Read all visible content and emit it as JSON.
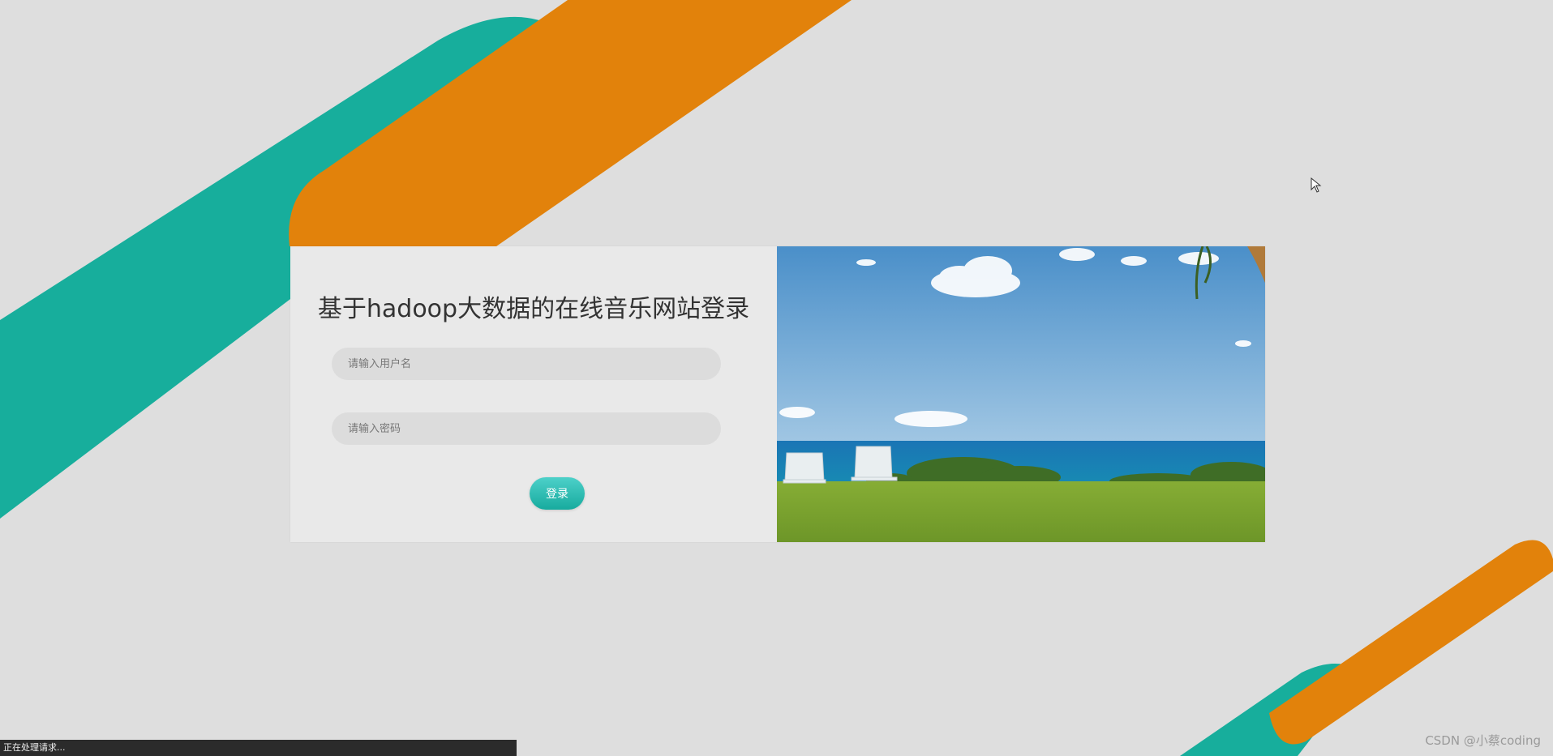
{
  "login": {
    "title": "基于hadoop大数据的在线音乐网站登录",
    "username_placeholder": "请输入用户名",
    "password_placeholder": "请输入密码",
    "login_label": "登录"
  },
  "status_bar": {
    "text": "正在处理请求..."
  },
  "watermark": {
    "text": "CSDN @小蔡coding"
  },
  "colors": {
    "background": "#dedede",
    "teal": "#17ae9c",
    "orange": "#e2820b",
    "panel": "#e9e9e9",
    "input": "#dcdcdc",
    "button_top": "#4dd0c9",
    "button_bottom": "#17ab9e"
  },
  "icons": {
    "cursor": "mouse-pointer-icon",
    "background": "diagonal-stripes-decoration",
    "image": "beach-landscape-image"
  }
}
